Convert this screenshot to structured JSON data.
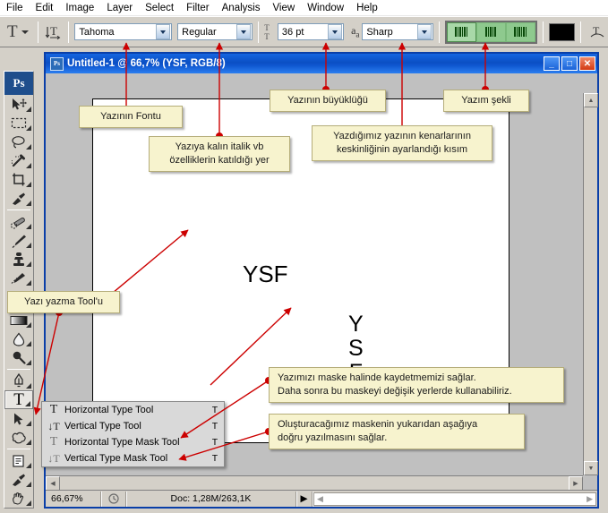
{
  "menubar": {
    "items": [
      {
        "label": "File"
      },
      {
        "label": "Edit"
      },
      {
        "label": "Image"
      },
      {
        "label": "Layer"
      },
      {
        "label": "Select"
      },
      {
        "label": "Filter"
      },
      {
        "label": "Analysis"
      },
      {
        "label": "View"
      },
      {
        "label": "Window"
      },
      {
        "label": "Help"
      }
    ]
  },
  "options_bar": {
    "tool_preset_icon": "type-tool-icon",
    "orientation_icon": "toggle-text-orientation-icon",
    "font_family": "Tahoma",
    "font_style": "Regular",
    "font_size": "36 pt",
    "antialias": "Sharp",
    "font_size_icon": "font-size-icon",
    "antialias_icon": "anti-alias-icon",
    "align": {
      "left_label": "align-left",
      "center_label": "align-center",
      "right_label": "align-right",
      "selected": "left"
    },
    "color_swatch": "#000000",
    "warp_icon": "warp-text-icon"
  },
  "tool_palette": {
    "badge": "Ps",
    "tools": [
      {
        "name": "move-tool"
      },
      {
        "name": "rectangular-marquee-tool"
      },
      {
        "name": "lasso-tool"
      },
      {
        "name": "magic-wand-tool"
      },
      {
        "name": "crop-tool"
      },
      {
        "name": "eyedropper-tool"
      },
      {
        "name": "healing-brush-tool"
      },
      {
        "name": "brush-tool"
      },
      {
        "name": "clone-stamp-tool"
      },
      {
        "name": "history-brush-tool"
      },
      {
        "name": "eraser-tool"
      },
      {
        "name": "gradient-tool"
      },
      {
        "name": "blur-tool"
      },
      {
        "name": "dodge-tool"
      },
      {
        "name": "pen-tool"
      },
      {
        "name": "type-tool",
        "label": "T",
        "selected": true
      },
      {
        "name": "path-selection-tool"
      },
      {
        "name": "shape-tool"
      },
      {
        "name": "notes-tool"
      },
      {
        "name": "eyedropper-bottom-tool"
      },
      {
        "name": "hand-tool"
      }
    ]
  },
  "document_window": {
    "title": "Untitled-1 @ 66,7% (YSF, RGB/8)",
    "app_icon": "photoshop-document-icon",
    "minimize": "_",
    "maximize": "□",
    "close": "✕",
    "canvas": {
      "horizontal_text": "YSF",
      "vertical_text": "Y\nS\nF"
    },
    "status": {
      "zoom": "66,67%",
      "clock_icon": "document-sizes-icon",
      "doc": "Doc: 1,28M/263,1K",
      "arrow": "▶"
    }
  },
  "flyout": {
    "items": [
      {
        "icon": "horizontal-type-tool-icon",
        "glyph": "T",
        "label": "Horizontal Type Tool",
        "key": "T"
      },
      {
        "icon": "vertical-type-tool-icon",
        "glyph": "↓T",
        "label": "Vertical Type Tool",
        "key": "T"
      },
      {
        "icon": "horizontal-type-mask-tool-icon",
        "glyph": "T",
        "label": "Horizontal Type Mask Tool",
        "key": "T"
      },
      {
        "icon": "vertical-type-mask-tool-icon",
        "glyph": "T",
        "label": "Vertical Type Mask Tool",
        "key": "T"
      }
    ]
  },
  "annotations": {
    "font": "Yazının Fontu",
    "style": "Yazıya kalın italik vb\nözelliklerin katıldığı yer",
    "size": "Yazının büyüklüğü",
    "antialias": "Yazdığımız yazının kenarlarının\nkeskinliğinin ayarlandığı kısım",
    "align": "Yazım şekli",
    "tool": "Yazı yazma Tool'u",
    "mask": "Yazımızı maske halinde kaydetmemizi sağlar.\nDaha sonra bu maskeyi değişik yerlerde kullanabiliriz.",
    "vertical_mask": "Oluşturacağımız maskenin yukarıdan aşağıya\ndoğru yazılmasını sağlar."
  },
  "accent": {
    "annotation_line": "#cc0000",
    "note_bg": "#f7f3ce",
    "title_blue": "#0b4fc4"
  }
}
